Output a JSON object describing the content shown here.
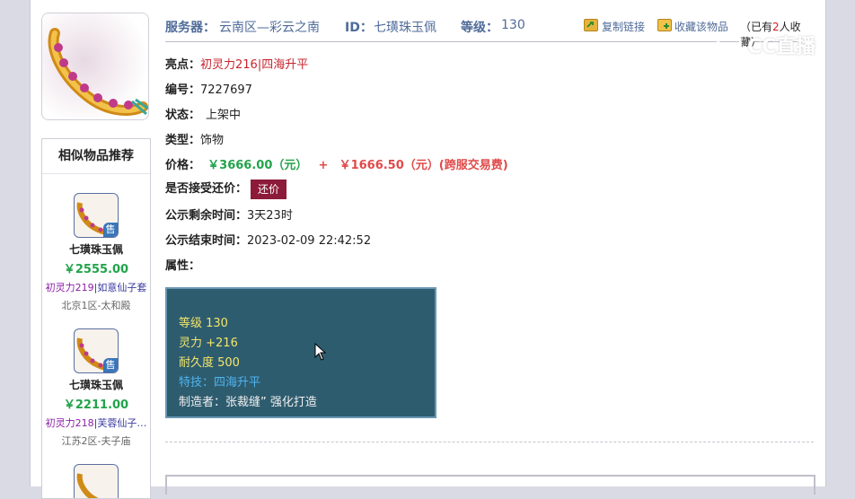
{
  "header": {
    "server_label": "服务器：",
    "server_value": "云南区—彩云之南",
    "id_label": "ID：",
    "id_value": "七璜珠玉佩",
    "level_label": "等级：",
    "level_value": "130",
    "copy_link": "复制链接",
    "favorite": "收藏该物品",
    "fav_prefix": "（已有",
    "fav_count": "2",
    "fav_suffix": "人收藏）"
  },
  "info": {
    "highlight_label": "亮点：",
    "highlight_value": "初灵力216|四海升平",
    "serial_label": "编号：",
    "serial_value": "7227697",
    "status_label": "状态：",
    "status_value": "上架中",
    "type_label": "类型：",
    "type_value": "饰物",
    "price_label": "价格：",
    "price_main": "￥3666.00（元）",
    "price_plus": "+",
    "price_fee": "￥1666.50（元）(跨服交易费)",
    "counter_label": "是否接受还价：",
    "counter_button": "还价",
    "remaining_label": "公示剩余时间：",
    "remaining_value": "3天23时",
    "end_label": "公示结束时间：",
    "end_value": "2023-02-09 22:42:52",
    "attr_label": "属性："
  },
  "attributes": {
    "level": "等级 130",
    "spirit": "灵力 +216",
    "durability": "耐久度 500",
    "skill": "特技：四海升平",
    "maker": "制造者：张裁缝” 强化打造"
  },
  "similar": {
    "title": "相似物品推荐",
    "sale_badge": "售",
    "items": [
      {
        "name": "七璜珠玉佩",
        "price": "￥2555.00",
        "attr1": "初灵力219",
        "attr2": "|如意仙子套",
        "server": "北京1区-太和殿"
      },
      {
        "name": "七璜珠玉佩",
        "price": "￥2211.00",
        "attr1": "初灵力218",
        "attr2": "|芙蓉仙子…",
        "server": "江苏2区-夫子庙"
      }
    ]
  },
  "watermark": {
    "text": "CC直播"
  },
  "colors": {
    "accent": "#4f6b99",
    "price": "#e04a4a",
    "green": "#22a34a",
    "panel": "#2e5c6f",
    "counter": "#8c1b39"
  },
  "icons": [
    "item-jade-pendant-icon",
    "copy-link-icon",
    "favorite-folder-icon",
    "sale-badge-icon",
    "mouse-cursor-icon"
  ]
}
